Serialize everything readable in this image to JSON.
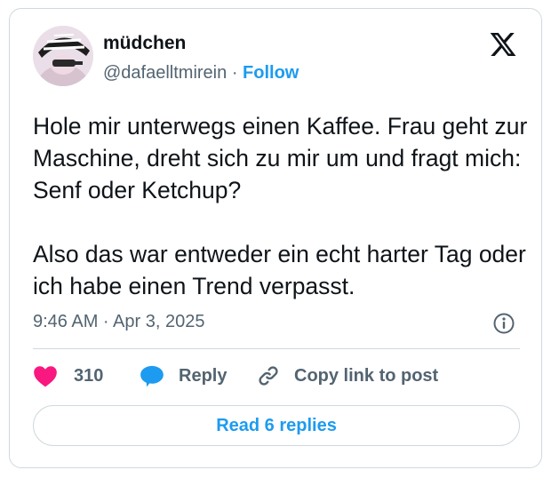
{
  "author": {
    "name": "müdchen",
    "handle": "@dafaelltmirein",
    "separator": "·",
    "follow_label": "Follow"
  },
  "tweet": {
    "text": "Hole mir unterwegs einen Kaffee. Frau geht zur Maschine, dreht sich zu mir um und fragt mich: Senf oder Ketchup?\n\nAlso das war entweder ein echt harter Tag oder ich habe einen Trend verpasst.",
    "timestamp": "9:46 AM · Apr 3, 2025"
  },
  "actions": {
    "like_count": "310",
    "reply_label": "Reply",
    "copy_link_label": "Copy link to post"
  },
  "read_replies_label": "Read 6 replies",
  "icons": {
    "brand": "x-logo-icon",
    "info": "info-icon",
    "like": "heart-icon",
    "reply": "speech-bubble-icon",
    "copy": "link-icon"
  },
  "colors": {
    "accent": "#1d9bf0",
    "like": "#f91880",
    "text": "#0f1419",
    "muted": "#536471",
    "border": "#cfd9de"
  }
}
